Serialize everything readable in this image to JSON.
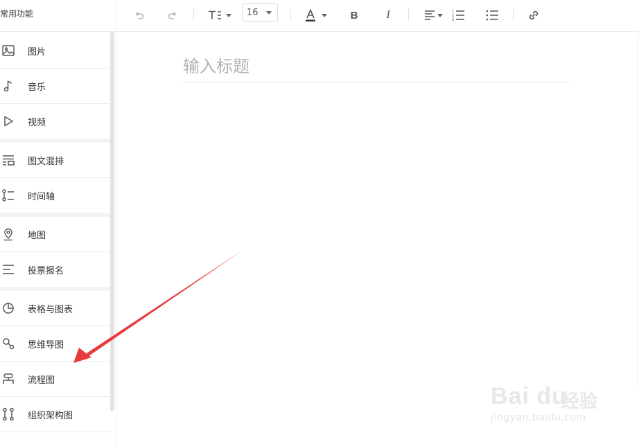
{
  "sidebar": {
    "title": "常用功能",
    "items": [
      {
        "label": "图片",
        "icon": "image-icon"
      },
      {
        "label": "音乐",
        "icon": "music-note-icon"
      },
      {
        "label": "视频",
        "icon": "play-icon"
      },
      {
        "label": "图文混排",
        "icon": "text-image-layout-icon"
      },
      {
        "label": "时间轴",
        "icon": "timeline-icon"
      },
      {
        "label": "地图",
        "icon": "map-pin-icon"
      },
      {
        "label": "投票报名",
        "icon": "list-lines-icon"
      },
      {
        "label": "表格与图表",
        "icon": "pie-chart-icon"
      },
      {
        "label": "思维导图",
        "icon": "mind-map-icon"
      },
      {
        "label": "流程图",
        "icon": "flowchart-icon"
      },
      {
        "label": "组织架构图",
        "icon": "org-chart-icon"
      }
    ]
  },
  "toolbar": {
    "font_size": "16",
    "bold_label": "B",
    "italic_label": "I",
    "font_color": "#333333"
  },
  "editor": {
    "title_placeholder": "输入标题"
  },
  "watermark": {
    "brand": "Bai du",
    "brand_cn": "经验",
    "url": "jingyan.baidu.com"
  },
  "colors": {
    "arrow": "#e83a3a",
    "border": "#ececec",
    "placeholder": "#b3b3b3"
  }
}
